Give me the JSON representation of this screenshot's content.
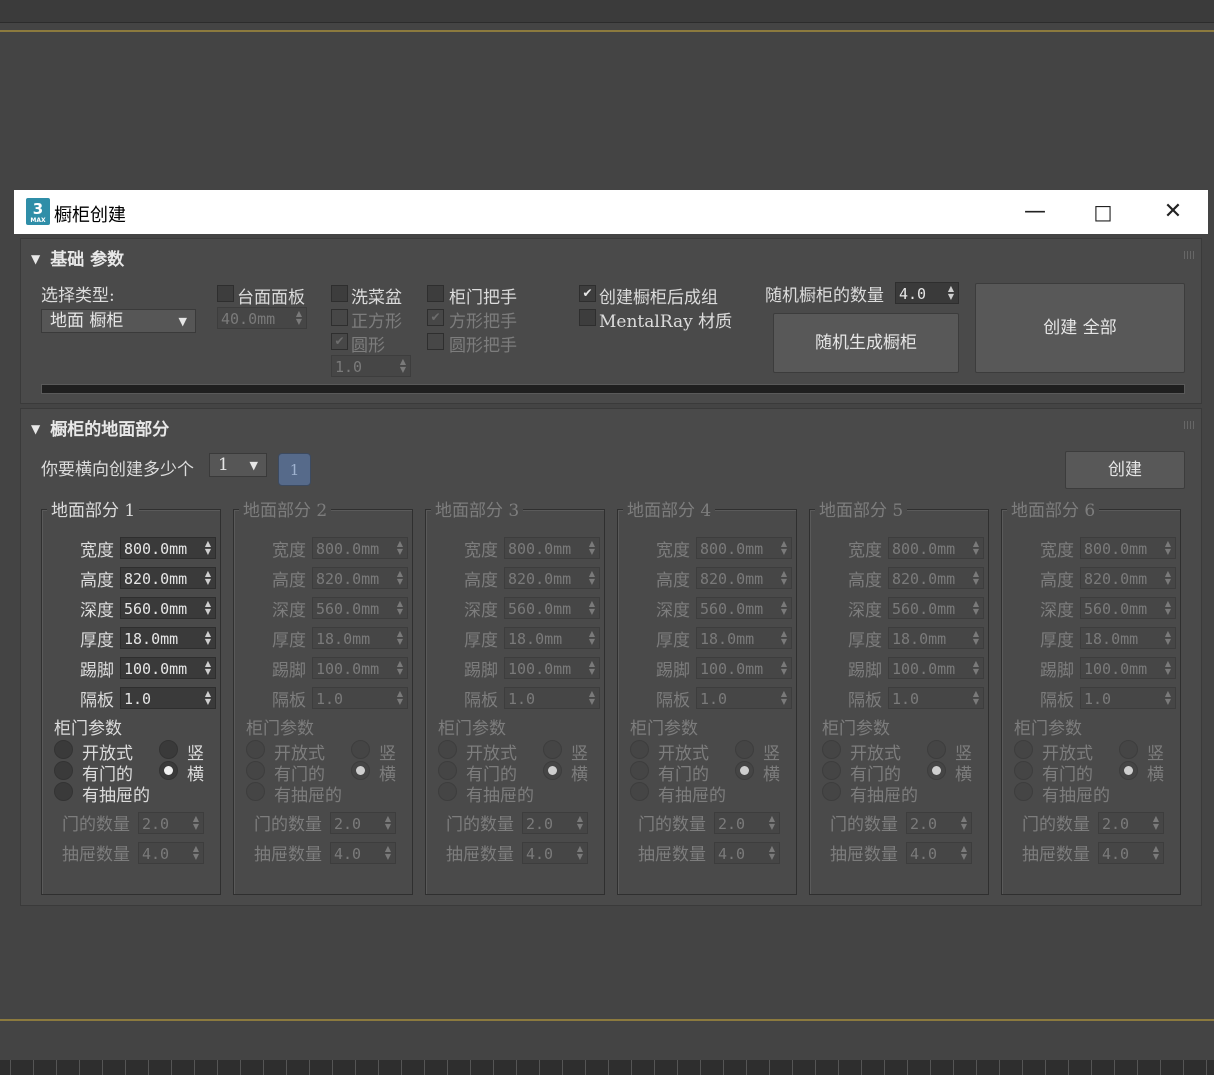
{
  "window": {
    "title": "橱柜创建",
    "icon_label": "3",
    "icon_sublabel": "MAX",
    "minimize_glyph": "—",
    "maximize_glyph": "□",
    "close_glyph": "✕"
  },
  "basic_params": {
    "header": "基础 参数",
    "select_type_label": "选择类型:",
    "select_type_value": "地面 橱柜",
    "countertop": {
      "label": "台面面板",
      "checked": false,
      "value": "40.0mm"
    },
    "sink": {
      "label": "洗菜盆",
      "checked": false,
      "square_label": "正方形",
      "round_label": "圆形",
      "round_checked": true,
      "value": "1.0"
    },
    "door_handle": {
      "label": "柜门把手",
      "checked": false,
      "square_label": "方形把手",
      "square_checked": true,
      "round_label": "圆形把手"
    },
    "group_after_create": {
      "label": "创建橱柜后成组",
      "checked": true
    },
    "mentalray": {
      "label": "MentalRay 材质",
      "checked": false
    },
    "random_count_label": "随机橱柜的数量",
    "random_count_value": "4.0",
    "random_button": "随机生成橱柜",
    "create_all_button": "创建 全部"
  },
  "floor_section": {
    "header": "橱柜的地面部分",
    "question_label": "你要横向创建多少个",
    "count_value": "1",
    "count_badge": "1",
    "create_button": "创建",
    "field_labels": [
      "宽度",
      "高度",
      "深度",
      "厚度",
      "踢脚",
      "隔板"
    ],
    "door_params_label": "柜门参数",
    "radio_labels": {
      "open": "开放式",
      "with_doors": "有门的",
      "with_drawers": "有抽屉的",
      "vertical": "竖",
      "horizontal": "横"
    },
    "door_count_label": "门的数量",
    "drawer_count_label": "抽屉数量",
    "parts": [
      {
        "title": "地面部分 1",
        "enabled": true,
        "values": [
          "800.0mm",
          "820.0mm",
          "560.0mm",
          "18.0mm",
          "100.0mm",
          "1.0"
        ],
        "door_count": "2.0",
        "drawer_count": "4.0"
      },
      {
        "title": "地面部分 2",
        "enabled": false,
        "values": [
          "800.0mm",
          "820.0mm",
          "560.0mm",
          "18.0mm",
          "100.0mm",
          "1.0"
        ],
        "door_count": "2.0",
        "drawer_count": "4.0"
      },
      {
        "title": "地面部分 3",
        "enabled": false,
        "values": [
          "800.0mm",
          "820.0mm",
          "560.0mm",
          "18.0mm",
          "100.0mm",
          "1.0"
        ],
        "door_count": "2.0",
        "drawer_count": "4.0"
      },
      {
        "title": "地面部分 4",
        "enabled": false,
        "values": [
          "800.0mm",
          "820.0mm",
          "560.0mm",
          "18.0mm",
          "100.0mm",
          "1.0"
        ],
        "door_count": "2.0",
        "drawer_count": "4.0"
      },
      {
        "title": "地面部分 5",
        "enabled": false,
        "values": [
          "800.0mm",
          "820.0mm",
          "560.0mm",
          "18.0mm",
          "100.0mm",
          "1.0"
        ],
        "door_count": "2.0",
        "drawer_count": "4.0"
      },
      {
        "title": "地面部分 6",
        "enabled": false,
        "values": [
          "800.0mm",
          "820.0mm",
          "560.0mm",
          "18.0mm",
          "100.0mm",
          "1.0"
        ],
        "door_count": "2.0",
        "drawer_count": "4.0"
      }
    ]
  },
  "colors": {
    "background": "#444444",
    "panel": "#4a4a4a",
    "accent_gold": "#8c7a3e",
    "badge": "#566a8a"
  }
}
